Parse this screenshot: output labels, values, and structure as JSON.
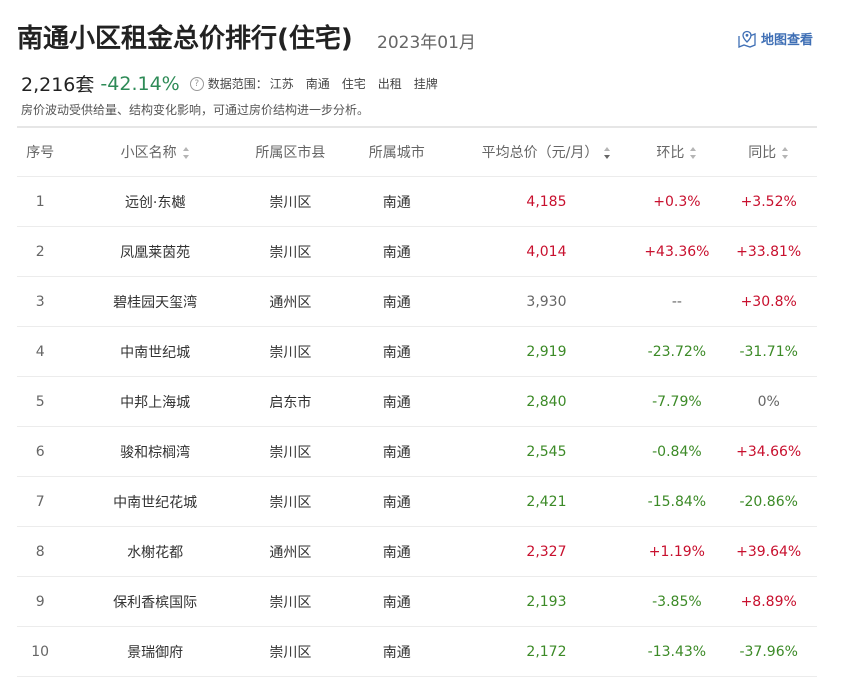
{
  "header": {
    "title": "南通小区租金总价排行(住宅)",
    "date": "2023年01月",
    "map_link": "地图查看"
  },
  "summary": {
    "count": "2,216套",
    "change": "-42.14%",
    "scope_label": "数据范围：",
    "scope_items": [
      "江苏",
      "南通",
      "住宅",
      "出租",
      "挂牌"
    ],
    "note": "房价波动受供给量、结构变化影响，可通过房价结构进一步分析。"
  },
  "table": {
    "columns": [
      "序号",
      "小区名称",
      "所属区市县",
      "所属城市",
      "平均总价（元/月）",
      "环比",
      "同比"
    ],
    "rows": [
      {
        "rank": "1",
        "name": "远创·东樾",
        "district": "崇川区",
        "city": "南通",
        "price": "4,185",
        "mom": "+0.3%",
        "yoy": "+3.52%"
      },
      {
        "rank": "2",
        "name": "凤凰莱茵苑",
        "district": "崇川区",
        "city": "南通",
        "price": "4,014",
        "mom": "+43.36%",
        "yoy": "+33.81%"
      },
      {
        "rank": "3",
        "name": "碧桂园天玺湾",
        "district": "通州区",
        "city": "南通",
        "price": "3,930",
        "mom": "--",
        "yoy": "+30.8%"
      },
      {
        "rank": "4",
        "name": "中南世纪城",
        "district": "崇川区",
        "city": "南通",
        "price": "2,919",
        "mom": "-23.72%",
        "yoy": "-31.71%"
      },
      {
        "rank": "5",
        "name": "中邦上海城",
        "district": "启东市",
        "city": "南通",
        "price": "2,840",
        "mom": "-7.79%",
        "yoy": "0%"
      },
      {
        "rank": "6",
        "name": "骏和棕榈湾",
        "district": "崇川区",
        "city": "南通",
        "price": "2,545",
        "mom": "-0.84%",
        "yoy": "+34.66%"
      },
      {
        "rank": "7",
        "name": "中南世纪花城",
        "district": "崇川区",
        "city": "南通",
        "price": "2,421",
        "mom": "-15.84%",
        "yoy": "-20.86%"
      },
      {
        "rank": "8",
        "name": "水榭花都",
        "district": "通州区",
        "city": "南通",
        "price": "2,327",
        "mom": "+1.19%",
        "yoy": "+39.64%"
      },
      {
        "rank": "9",
        "name": "保利香槟国际",
        "district": "崇川区",
        "city": "南通",
        "price": "2,193",
        "mom": "-3.85%",
        "yoy": "+8.89%"
      },
      {
        "rank": "10",
        "name": "景瑞御府",
        "district": "崇川区",
        "city": "南通",
        "price": "2,172",
        "mom": "-13.43%",
        "yoy": "-37.96%"
      }
    ]
  },
  "colors": {
    "up": "#c8102e",
    "down": "#3c8a27",
    "neutral": "#666666",
    "link": "#3f6fb5"
  },
  "icons": {
    "map_link": "map-pin-icon",
    "help": "help-icon",
    "sort": "sort-icon"
  }
}
